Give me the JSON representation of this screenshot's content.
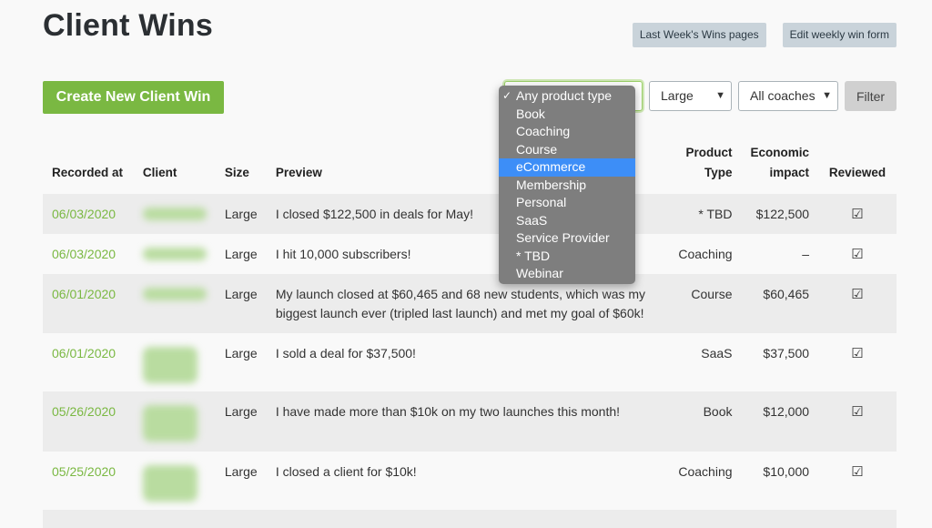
{
  "page": {
    "title": "Client Wins",
    "top_links": [
      "Last Week's Wins pages",
      "Edit weekly win form"
    ],
    "create_button": "Create New Client Win"
  },
  "filters": {
    "product_type": "Any product type",
    "size": "Large",
    "coach": "All coaches",
    "filter_button": "Filter"
  },
  "dropdown": {
    "options": [
      "Any product type",
      "Book",
      "Coaching",
      "Course",
      "eCommerce",
      "Membership",
      "Personal",
      "SaaS",
      "Service Provider",
      "* TBD",
      "Webinar"
    ],
    "checked": "Any product type",
    "highlighted": "eCommerce"
  },
  "table": {
    "headers": {
      "recorded_at": "Recorded at",
      "client": "Client",
      "size": "Size",
      "preview": "Preview",
      "product_type_l1": "Product",
      "product_type_l2": "Type",
      "impact_l1": "Economic",
      "impact_l2": "impact",
      "reviewed": "Reviewed"
    },
    "rows": [
      {
        "date": "06/03/2020",
        "size": "Large",
        "preview": "I closed $122,500 in deals for May!",
        "product": "* TBD",
        "impact": "$122,500"
      },
      {
        "date": "06/03/2020",
        "size": "Large",
        "preview": "I hit 10,000 subscribers!",
        "product": "Coaching",
        "impact": "–"
      },
      {
        "date": "06/01/2020",
        "size": "Large",
        "preview": "My launch closed at $60,465 and 68 new students, which was my biggest launch ever (tripled last launch) and met my goal of $60k!",
        "product": "Course",
        "impact": "$60,465"
      },
      {
        "date": "06/01/2020",
        "size": "Large",
        "preview": "I sold a deal for $37,500!",
        "product": "SaaS",
        "impact": "$37,500"
      },
      {
        "date": "05/26/2020",
        "size": "Large",
        "preview": "I have made more than $10k on my two launches this month!",
        "product": "Book",
        "impact": "$12,000"
      },
      {
        "date": "05/25/2020",
        "size": "Large",
        "preview": "I closed a client for $10k!",
        "product": "Coaching",
        "impact": "$10,000"
      }
    ]
  },
  "colors": {
    "accent_green": "#7ab842",
    "highlight_blue": "#3d8ef7",
    "link_button_bg": "#c9d3da"
  },
  "icons": {
    "reviewed": "checked-checkbox-icon",
    "select_chevron": "chevron-down-icon"
  }
}
